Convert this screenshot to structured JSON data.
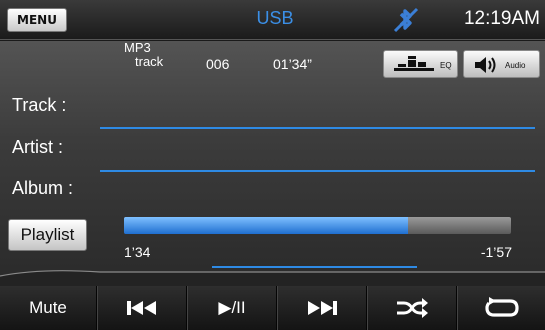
{
  "header": {
    "menu_label": "MENU",
    "source": "USB",
    "bluetooth_icon": "bluetooth-off-icon",
    "clock": "12:19AM"
  },
  "track_info": {
    "format": "MP3",
    "format_sub": "track",
    "track_number": "006",
    "elapsed": "01’34”"
  },
  "buttons": {
    "eq_label": "EQ",
    "audio_label": "Audio"
  },
  "fields": {
    "track_label": "Track  :",
    "artist_label": "Artist  :",
    "album_label": "Album :"
  },
  "playlist_label": "Playlist",
  "progress": {
    "fraction": 0.735,
    "elapsed": "1’34",
    "remaining": "-1’57"
  },
  "controls": {
    "mute_label": "Mute",
    "play_pause_label": "▶/II",
    "icons": [
      "previous-track-icon",
      "play-pause-icon",
      "next-track-icon",
      "shuffle-icon",
      "repeat-icon"
    ]
  },
  "colors": {
    "accent_blue": "#2e8ae4",
    "title_blue": "#3b8fe6"
  }
}
